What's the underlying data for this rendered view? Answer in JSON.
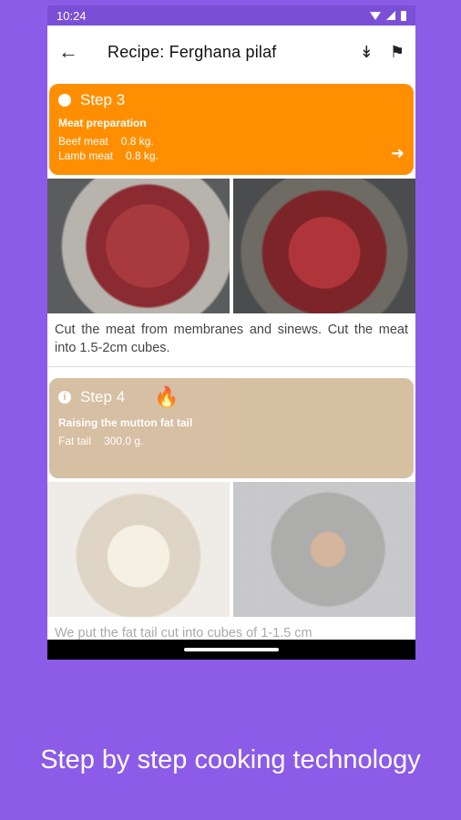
{
  "status_bar": {
    "time": "10:24"
  },
  "appbar": {
    "back_icon": "arrow-left-icon",
    "title": "Recipe: Ferghana pilaf",
    "collapse_icon": "double-chevron-down-icon",
    "finish_icon": "checkered-flag-icon"
  },
  "steps": [
    {
      "label": "Step 3",
      "subtitle": "Meat preparation",
      "ingredients": [
        {
          "name": "Beef meat",
          "amount": "0.8 kg."
        },
        {
          "name": "Lamb meat",
          "amount": "0.8 kg."
        }
      ],
      "description": "Cut the meat from membranes and sinews. Cut the meat into 1.5-2cm cubes.",
      "color": "#ff8f00"
    },
    {
      "label": "Step 4",
      "subtitle": "Raising the mutton fat tail",
      "ingredients": [
        {
          "name": "Fat tail",
          "amount": "300.0 g."
        }
      ],
      "description": "We put the fat tail cut into cubes of 1-1.5 cm",
      "color": "#d2b998"
    }
  ],
  "caption": "Step by step cooking technology",
  "colors": {
    "background": "#8c5ce8",
    "accent": "#ff8f00"
  }
}
